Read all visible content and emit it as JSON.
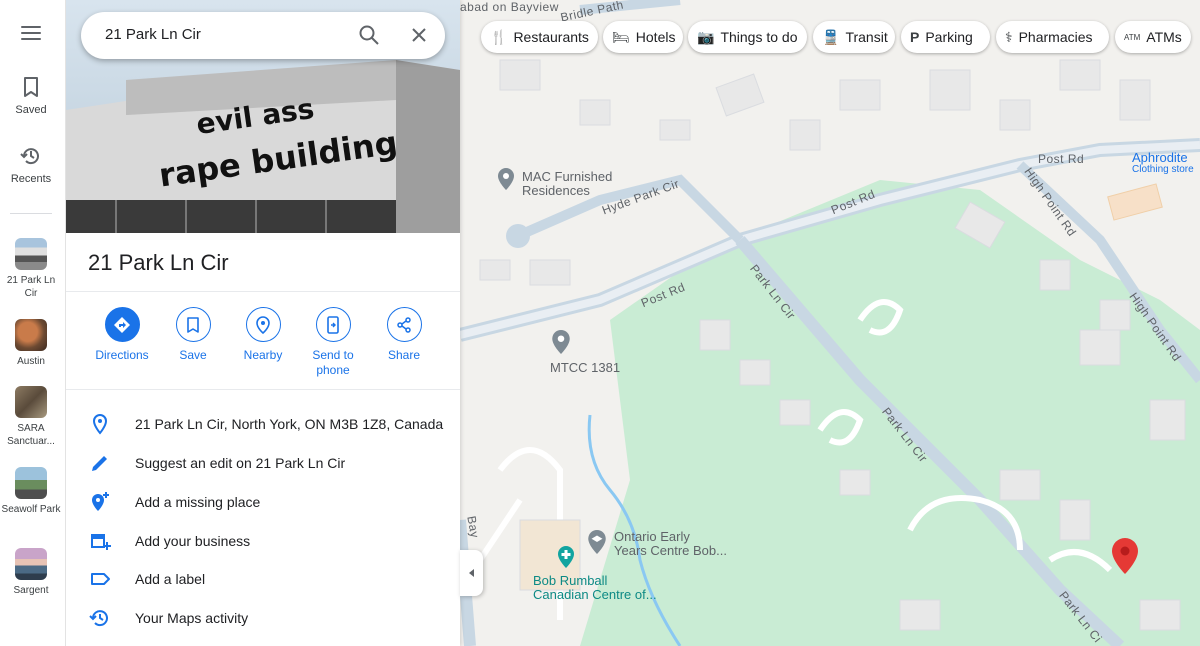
{
  "rail": {
    "saved": "Saved",
    "recents": "Recents",
    "recent_places": [
      {
        "label": "21 Park Ln Cir"
      },
      {
        "label": "Austin"
      },
      {
        "label": "SARA Sanctuar..."
      },
      {
        "label": "Seawolf Park"
      },
      {
        "label": "Sargent"
      }
    ]
  },
  "search": {
    "query": "21 Park Ln Cir"
  },
  "hero": {
    "line1": "evil ass",
    "line2": "rape building"
  },
  "place": {
    "title": "21 Park Ln Cir",
    "actions": [
      {
        "label": "Directions"
      },
      {
        "label": "Save"
      },
      {
        "label": "Nearby"
      },
      {
        "label": "Send to phone"
      },
      {
        "label": "Share"
      }
    ],
    "info_rows": [
      {
        "icon": "location-pin-icon",
        "text": "21 Park Ln Cir, North York, ON M3B 1Z8, Canada"
      },
      {
        "icon": "pencil-icon",
        "text": "Suggest an edit on 21 Park Ln Cir"
      },
      {
        "icon": "add-place-icon",
        "text": "Add a missing place"
      },
      {
        "icon": "add-business-icon",
        "text": "Add your business"
      },
      {
        "icon": "label-icon",
        "text": "Add a label"
      },
      {
        "icon": "history-icon",
        "text": "Your Maps activity"
      }
    ]
  },
  "chips": [
    {
      "icon": "fork-knife-icon",
      "label": "Restaurants"
    },
    {
      "icon": "bed-icon",
      "label": "Hotels"
    },
    {
      "icon": "camera-icon",
      "label": "Things to do"
    },
    {
      "icon": "train-icon",
      "label": "Transit"
    },
    {
      "icon": "parking-icon",
      "label": "Parking"
    },
    {
      "icon": "pharmacy-icon",
      "label": "Pharmacies"
    },
    {
      "icon": "atm-icon",
      "label": "ATMs"
    }
  ],
  "map": {
    "roads": {
      "bridle_path": "Bridle Path",
      "bayview_top": "abad on Bayview",
      "post_rd_1": "Post Rd",
      "post_rd_2": "Post Rd",
      "post_rd_3": "Post Rd",
      "hyde_park": "Hyde Park Cir",
      "high_point_1": "High Point Rd",
      "high_point_2": "High Point Rd",
      "park_ln_1": "Park Ln Cir",
      "park_ln_2": "Park Ln Cir",
      "park_ln_3": "Park Ln Ci",
      "bayview_side": "Bay"
    },
    "pois": {
      "mac_name": "MAC Furnished",
      "mac_name2": "Residences",
      "mtcc": "MTCC 1381",
      "aphrodite": "Aphrodite",
      "aphrodite_sub": "Clothing store",
      "ontario": "Ontario Early",
      "ontario2": "Years Centre Bob...",
      "bob": "Bob Rumball",
      "bob2": "Canadian Centre of..."
    },
    "colors": {
      "park": "#c9ecd4",
      "road": "#ffffff",
      "road_blue": "#c8d7e3",
      "water": "#8ac8f2",
      "pin": "#e53935",
      "accent": "#1a73e8"
    }
  }
}
